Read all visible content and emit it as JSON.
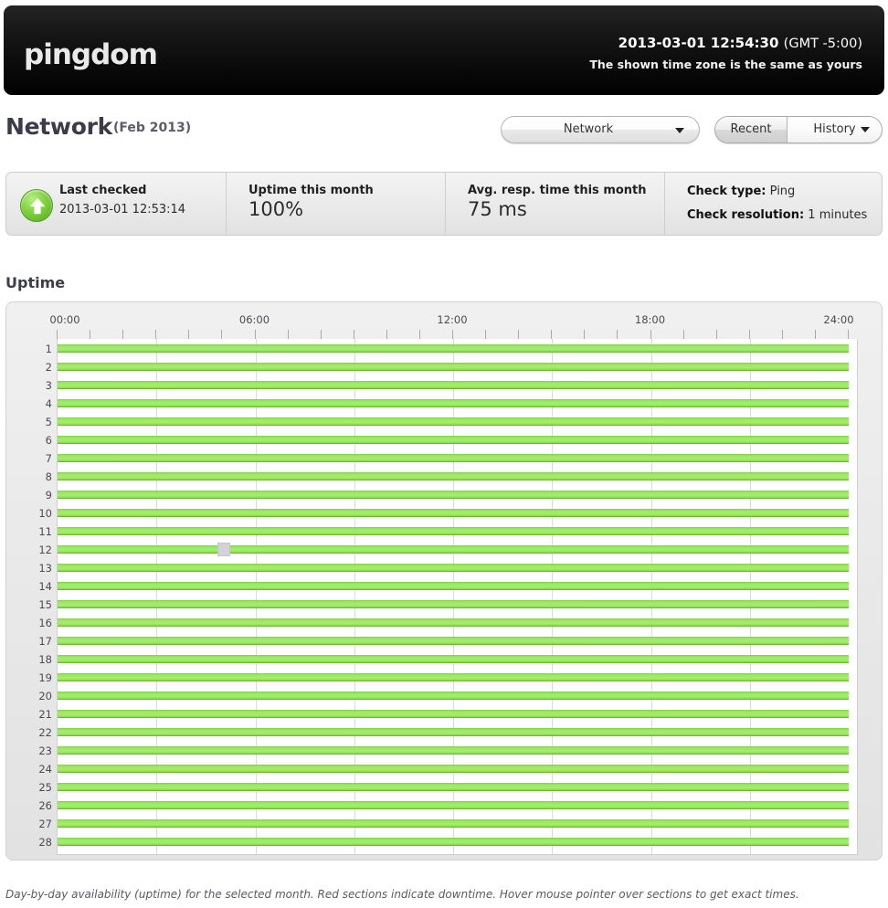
{
  "brand": {
    "logo_text": "pingdom"
  },
  "header": {
    "datetime": "2013-03-01 12:54:30",
    "gmt": "(GMT -5:00)",
    "timezone_note": "The shown time zone is the same as yours"
  },
  "title": {
    "name": "Network",
    "period": "(Feb 2013)"
  },
  "check_selector": {
    "value": "Network",
    "caret": "chevron-down-icon"
  },
  "view_tabs": {
    "items": [
      {
        "label": "Recent",
        "active": false
      },
      {
        "label": "History",
        "active": true
      }
    ],
    "caret": "chevron-down-icon"
  },
  "stats": {
    "last_checked": {
      "label": "Last checked",
      "value": "2013-03-01 12:53:14",
      "icon": "status-up-arrow-icon"
    },
    "uptime_month": {
      "label": "Uptime this month",
      "value": "100%"
    },
    "avg_resp": {
      "label": "Avg. resp. time this month",
      "value": "75 ms"
    },
    "check_type": {
      "label": "Check type:",
      "value": "Ping"
    },
    "check_resolution": {
      "label": "Check resolution:",
      "value": "1 minutes"
    }
  },
  "section": {
    "uptime_heading": "Uptime"
  },
  "footer": {
    "caption": "Day-by-day availability (uptime) for the selected month. Red sections indicate downtime. Hover mouse pointer over sections to get exact times."
  },
  "colors": {
    "uptime_green": "#9ae85f",
    "uptime_green_edge": "#4f9a1e",
    "downtime_red": "#e03030",
    "panel_bg": "#eaeaea",
    "hover_highlight": "#d3d3d6"
  },
  "chart_data": {
    "type": "bar",
    "title": "Uptime",
    "subtitle": "Day-by-day availability (uptime) for Feb 2013",
    "orientation": "horizontal",
    "xlabel": "",
    "ylabel": "",
    "xlim": [
      0,
      24
    ],
    "x_tick_labels": [
      "00:00",
      "06:00",
      "12:00",
      "18:00",
      "24:00"
    ],
    "x_tick_values": [
      0,
      6,
      12,
      18,
      24
    ],
    "x_minor_tick_interval_hours": 1,
    "grid": true,
    "legend": "none",
    "categories": [
      1,
      2,
      3,
      4,
      5,
      6,
      7,
      8,
      9,
      10,
      11,
      12,
      13,
      14,
      15,
      16,
      17,
      18,
      19,
      20,
      21,
      22,
      23,
      24,
      25,
      26,
      27,
      28
    ],
    "series": [
      {
        "name": "Uptime",
        "color": "#9ae85f",
        "values": [
          100,
          100,
          100,
          100,
          100,
          100,
          100,
          100,
          100,
          100,
          100,
          100,
          100,
          100,
          100,
          100,
          100,
          100,
          100,
          100,
          100,
          100,
          100,
          100,
          100,
          100,
          100,
          100
        ],
        "unit": "%"
      }
    ],
    "annotations": [
      {
        "type": "hover-highlight",
        "day": 12,
        "start_hour": 4.85,
        "end_hour": 5.25,
        "color": "#d3d3d6"
      }
    ]
  }
}
